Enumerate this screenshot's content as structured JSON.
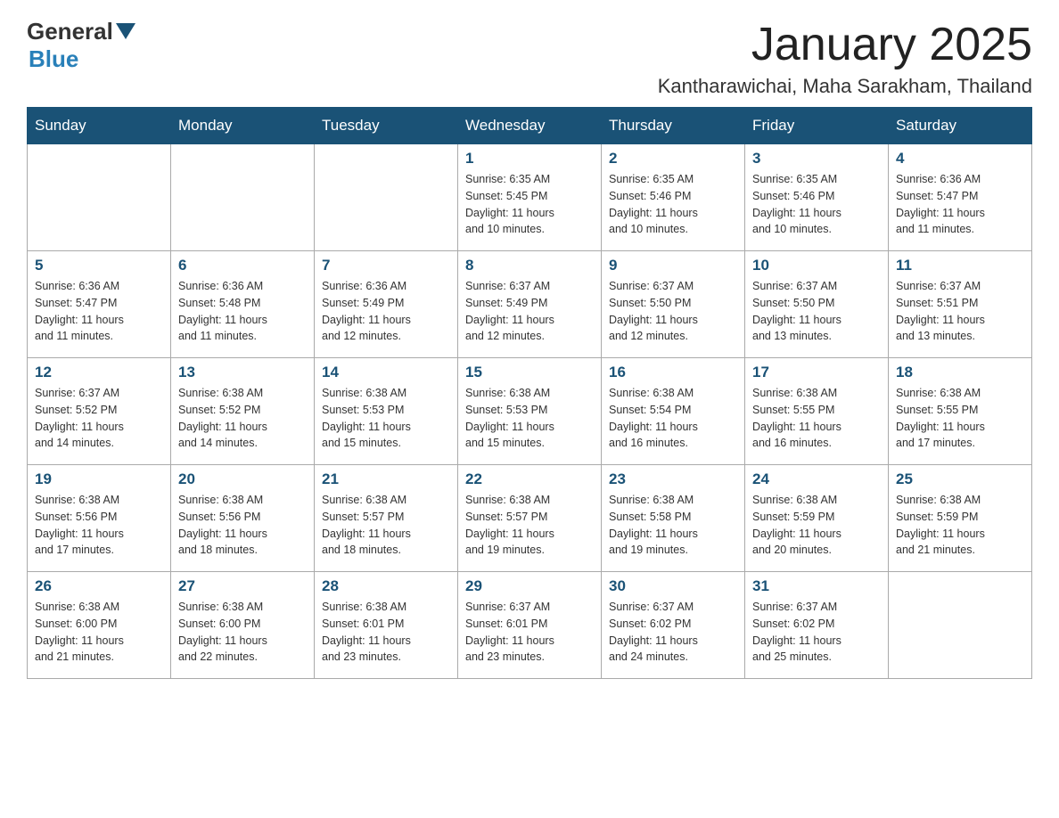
{
  "header": {
    "logo": {
      "general": "General",
      "blue": "Blue",
      "arrow_color": "#1a5276"
    },
    "title": "January 2025",
    "location": "Kantharawichai, Maha Sarakham, Thailand"
  },
  "calendar": {
    "days_of_week": [
      "Sunday",
      "Monday",
      "Tuesday",
      "Wednesday",
      "Thursday",
      "Friday",
      "Saturday"
    ],
    "weeks": [
      [
        {
          "day": "",
          "info": ""
        },
        {
          "day": "",
          "info": ""
        },
        {
          "day": "",
          "info": ""
        },
        {
          "day": "1",
          "info": "Sunrise: 6:35 AM\nSunset: 5:45 PM\nDaylight: 11 hours\nand 10 minutes."
        },
        {
          "day": "2",
          "info": "Sunrise: 6:35 AM\nSunset: 5:46 PM\nDaylight: 11 hours\nand 10 minutes."
        },
        {
          "day": "3",
          "info": "Sunrise: 6:35 AM\nSunset: 5:46 PM\nDaylight: 11 hours\nand 10 minutes."
        },
        {
          "day": "4",
          "info": "Sunrise: 6:36 AM\nSunset: 5:47 PM\nDaylight: 11 hours\nand 11 minutes."
        }
      ],
      [
        {
          "day": "5",
          "info": "Sunrise: 6:36 AM\nSunset: 5:47 PM\nDaylight: 11 hours\nand 11 minutes."
        },
        {
          "day": "6",
          "info": "Sunrise: 6:36 AM\nSunset: 5:48 PM\nDaylight: 11 hours\nand 11 minutes."
        },
        {
          "day": "7",
          "info": "Sunrise: 6:36 AM\nSunset: 5:49 PM\nDaylight: 11 hours\nand 12 minutes."
        },
        {
          "day": "8",
          "info": "Sunrise: 6:37 AM\nSunset: 5:49 PM\nDaylight: 11 hours\nand 12 minutes."
        },
        {
          "day": "9",
          "info": "Sunrise: 6:37 AM\nSunset: 5:50 PM\nDaylight: 11 hours\nand 12 minutes."
        },
        {
          "day": "10",
          "info": "Sunrise: 6:37 AM\nSunset: 5:50 PM\nDaylight: 11 hours\nand 13 minutes."
        },
        {
          "day": "11",
          "info": "Sunrise: 6:37 AM\nSunset: 5:51 PM\nDaylight: 11 hours\nand 13 minutes."
        }
      ],
      [
        {
          "day": "12",
          "info": "Sunrise: 6:37 AM\nSunset: 5:52 PM\nDaylight: 11 hours\nand 14 minutes."
        },
        {
          "day": "13",
          "info": "Sunrise: 6:38 AM\nSunset: 5:52 PM\nDaylight: 11 hours\nand 14 minutes."
        },
        {
          "day": "14",
          "info": "Sunrise: 6:38 AM\nSunset: 5:53 PM\nDaylight: 11 hours\nand 15 minutes."
        },
        {
          "day": "15",
          "info": "Sunrise: 6:38 AM\nSunset: 5:53 PM\nDaylight: 11 hours\nand 15 minutes."
        },
        {
          "day": "16",
          "info": "Sunrise: 6:38 AM\nSunset: 5:54 PM\nDaylight: 11 hours\nand 16 minutes."
        },
        {
          "day": "17",
          "info": "Sunrise: 6:38 AM\nSunset: 5:55 PM\nDaylight: 11 hours\nand 16 minutes."
        },
        {
          "day": "18",
          "info": "Sunrise: 6:38 AM\nSunset: 5:55 PM\nDaylight: 11 hours\nand 17 minutes."
        }
      ],
      [
        {
          "day": "19",
          "info": "Sunrise: 6:38 AM\nSunset: 5:56 PM\nDaylight: 11 hours\nand 17 minutes."
        },
        {
          "day": "20",
          "info": "Sunrise: 6:38 AM\nSunset: 5:56 PM\nDaylight: 11 hours\nand 18 minutes."
        },
        {
          "day": "21",
          "info": "Sunrise: 6:38 AM\nSunset: 5:57 PM\nDaylight: 11 hours\nand 18 minutes."
        },
        {
          "day": "22",
          "info": "Sunrise: 6:38 AM\nSunset: 5:57 PM\nDaylight: 11 hours\nand 19 minutes."
        },
        {
          "day": "23",
          "info": "Sunrise: 6:38 AM\nSunset: 5:58 PM\nDaylight: 11 hours\nand 19 minutes."
        },
        {
          "day": "24",
          "info": "Sunrise: 6:38 AM\nSunset: 5:59 PM\nDaylight: 11 hours\nand 20 minutes."
        },
        {
          "day": "25",
          "info": "Sunrise: 6:38 AM\nSunset: 5:59 PM\nDaylight: 11 hours\nand 21 minutes."
        }
      ],
      [
        {
          "day": "26",
          "info": "Sunrise: 6:38 AM\nSunset: 6:00 PM\nDaylight: 11 hours\nand 21 minutes."
        },
        {
          "day": "27",
          "info": "Sunrise: 6:38 AM\nSunset: 6:00 PM\nDaylight: 11 hours\nand 22 minutes."
        },
        {
          "day": "28",
          "info": "Sunrise: 6:38 AM\nSunset: 6:01 PM\nDaylight: 11 hours\nand 23 minutes."
        },
        {
          "day": "29",
          "info": "Sunrise: 6:37 AM\nSunset: 6:01 PM\nDaylight: 11 hours\nand 23 minutes."
        },
        {
          "day": "30",
          "info": "Sunrise: 6:37 AM\nSunset: 6:02 PM\nDaylight: 11 hours\nand 24 minutes."
        },
        {
          "day": "31",
          "info": "Sunrise: 6:37 AM\nSunset: 6:02 PM\nDaylight: 11 hours\nand 25 minutes."
        },
        {
          "day": "",
          "info": ""
        }
      ]
    ]
  }
}
